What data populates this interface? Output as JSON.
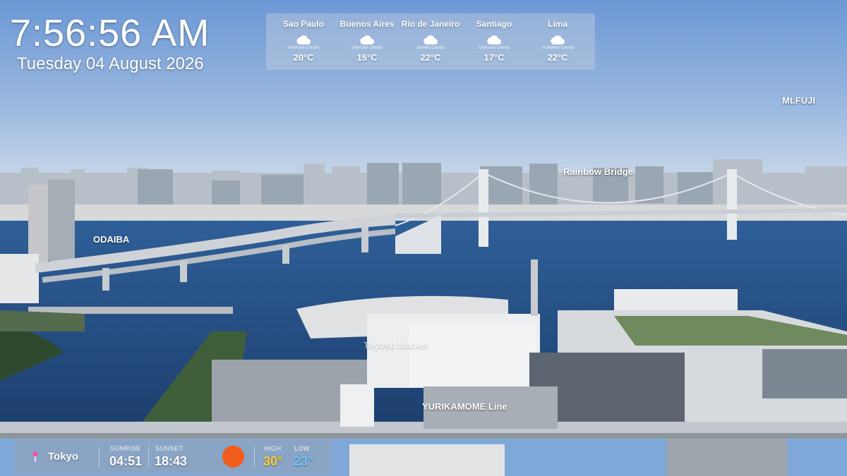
{
  "clock": {
    "time": "7:56:56 AM",
    "date": "Tuesday 04 August 2026"
  },
  "weather": {
    "cities": [
      {
        "name": "Sao Paulo",
        "condition": "Overcast Clouds",
        "temp": "20°C",
        "icon": "cloud-icon"
      },
      {
        "name": "Buenos Aires",
        "condition": "Overcast Clouds",
        "temp": "15°C",
        "icon": "cloud-icon"
      },
      {
        "name": "Rio de Janeiro",
        "condition": "Broken Clouds",
        "temp": "22°C",
        "icon": "cloud-icon"
      },
      {
        "name": "Santiago",
        "condition": "Overcast Clouds",
        "temp": "17°C",
        "icon": "cloud-icon"
      },
      {
        "name": "Lima",
        "condition": "Scattered Clouds",
        "temp": "22°C",
        "icon": "cloud-icon"
      }
    ]
  },
  "labels": {
    "mtfuji": "Mt.FUJI",
    "rainbow_bridge": "Rainbow Bridge",
    "odaiba": "ODAIBA",
    "market": "Toyosu Market",
    "yurikamome": "YURIKAMOME Line"
  },
  "info": {
    "location": "Tokyo",
    "sunrise_label": "SUNRISE",
    "sunrise": "04:51",
    "sunset_label": "SUNSET",
    "sunset": "18:43",
    "high_label": "HIGH",
    "high": "30°",
    "low_label": "LOW",
    "low": "23°",
    "sun_icon": "sun-icon",
    "pin_icon": "pin-icon"
  },
  "colors": {
    "sun": "#f25c1c",
    "high": "#ffcf33",
    "low": "#6ec6ff",
    "sky_top": "#6f9bd6",
    "water": "#254f86"
  }
}
